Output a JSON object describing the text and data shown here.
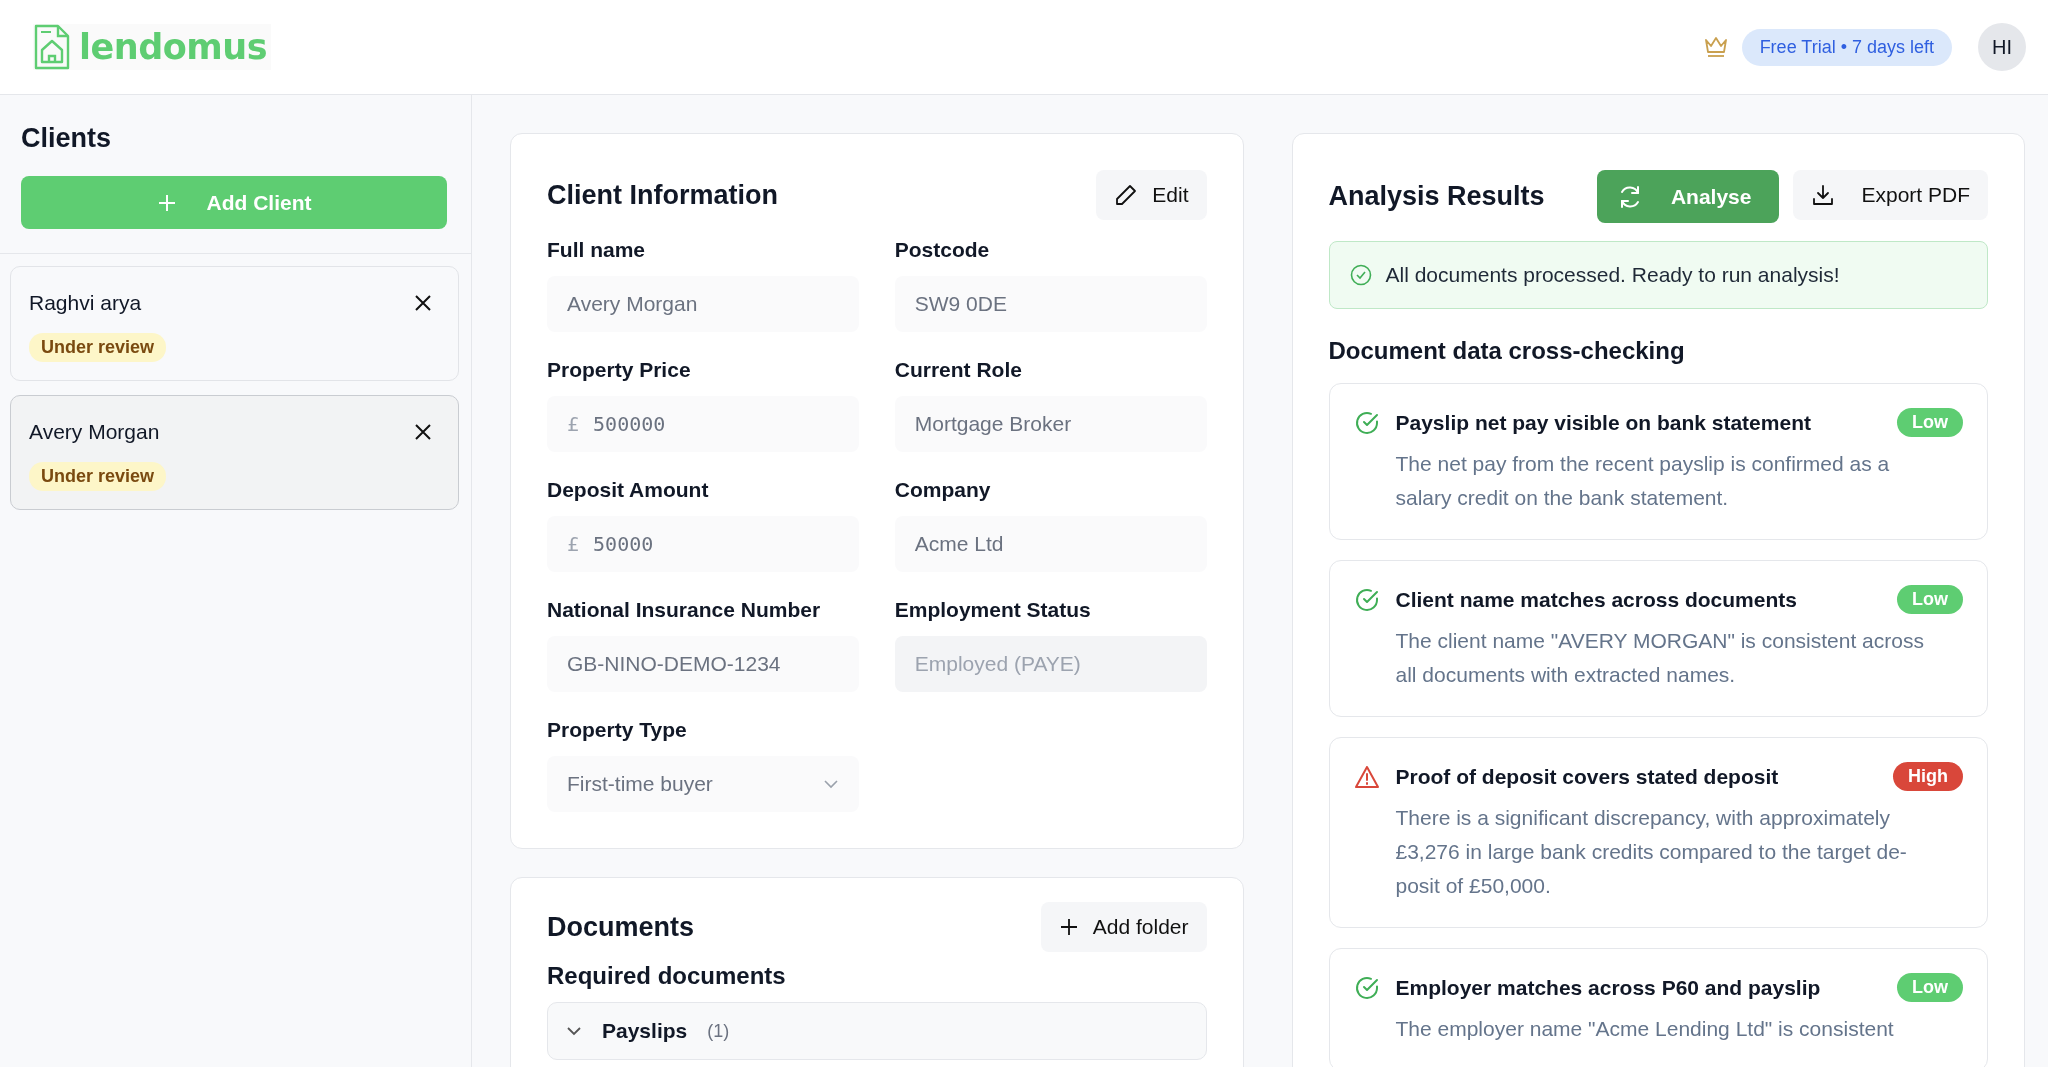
{
  "header": {
    "logo": "lendomus",
    "trial_badge": "Free Trial • 7 days left",
    "avatar": "HI"
  },
  "sidebar": {
    "title": "Clients",
    "add_button": "Add Client",
    "clients": [
      {
        "name": "Raghvi arya",
        "status": "Under review",
        "selected": false
      },
      {
        "name": "Avery Morgan",
        "status": "Under review",
        "selected": true
      }
    ]
  },
  "client_information": {
    "title": "Client Information",
    "edit_button": "Edit",
    "fields": [
      {
        "label": "Full name",
        "value": "Avery Morgan",
        "kind": "text",
        "disabled": false
      },
      {
        "label": "Postcode",
        "value": "SW9 0DE",
        "kind": "text",
        "disabled": false
      },
      {
        "label": "Property Price",
        "prefix": "£",
        "value": "500000",
        "kind": "currency",
        "disabled": false
      },
      {
        "label": "Current Role",
        "value": "Mortgage Broker",
        "kind": "text",
        "disabled": false
      },
      {
        "label": "Deposit Amount",
        "prefix": "£",
        "value": "50000",
        "kind": "currency",
        "disabled": false
      },
      {
        "label": "Company",
        "value": "Acme Ltd",
        "kind": "text",
        "disabled": false
      },
      {
        "label": "National Insurance Number",
        "value": "GB-NINO-DEMO-1234",
        "kind": "text",
        "disabled": false
      },
      {
        "label": "Employment Status",
        "value": "Employed (PAYE)",
        "kind": "text",
        "disabled": true
      },
      {
        "label": "Property Type",
        "value": "First-time buyer",
        "kind": "select",
        "disabled": false
      }
    ]
  },
  "documents": {
    "title": "Documents",
    "add_folder_button": "Add folder",
    "section_title": "Required documents",
    "folders": [
      {
        "name": "Payslips",
        "count": "(1)",
        "expanded": true
      }
    ]
  },
  "analysis": {
    "title": "Analysis Results",
    "analyse_button": "Analyse",
    "export_button": "Export PDF",
    "notice": "All documents processed. Ready to run analysis!",
    "section_title": "Document data cross-checking",
    "checks": [
      {
        "title": "Payslip net pay visible on bank statement",
        "severity": "Low",
        "kind": "pass",
        "detail": "The net pay from the recent payslip is confirmed as a salary credit on the bank statement."
      },
      {
        "title": "Client name matches across documents",
        "severity": "Low",
        "kind": "pass",
        "detail": "The client name \"AVERY MORGAN\" is consistent across all documents with extracted names."
      },
      {
        "title": "Proof of deposit covers stated deposit",
        "severity": "High",
        "kind": "warn",
        "detail": "There is a significant discrepancy, with approximately £3,276 in large bank credits compared to the target de-posit of £50,000."
      },
      {
        "title": "Employer matches across P60 and payslip",
        "severity": "Low",
        "kind": "pass",
        "detail": "The employer name \"Acme Lending Ltd\" is consistent"
      }
    ]
  }
}
